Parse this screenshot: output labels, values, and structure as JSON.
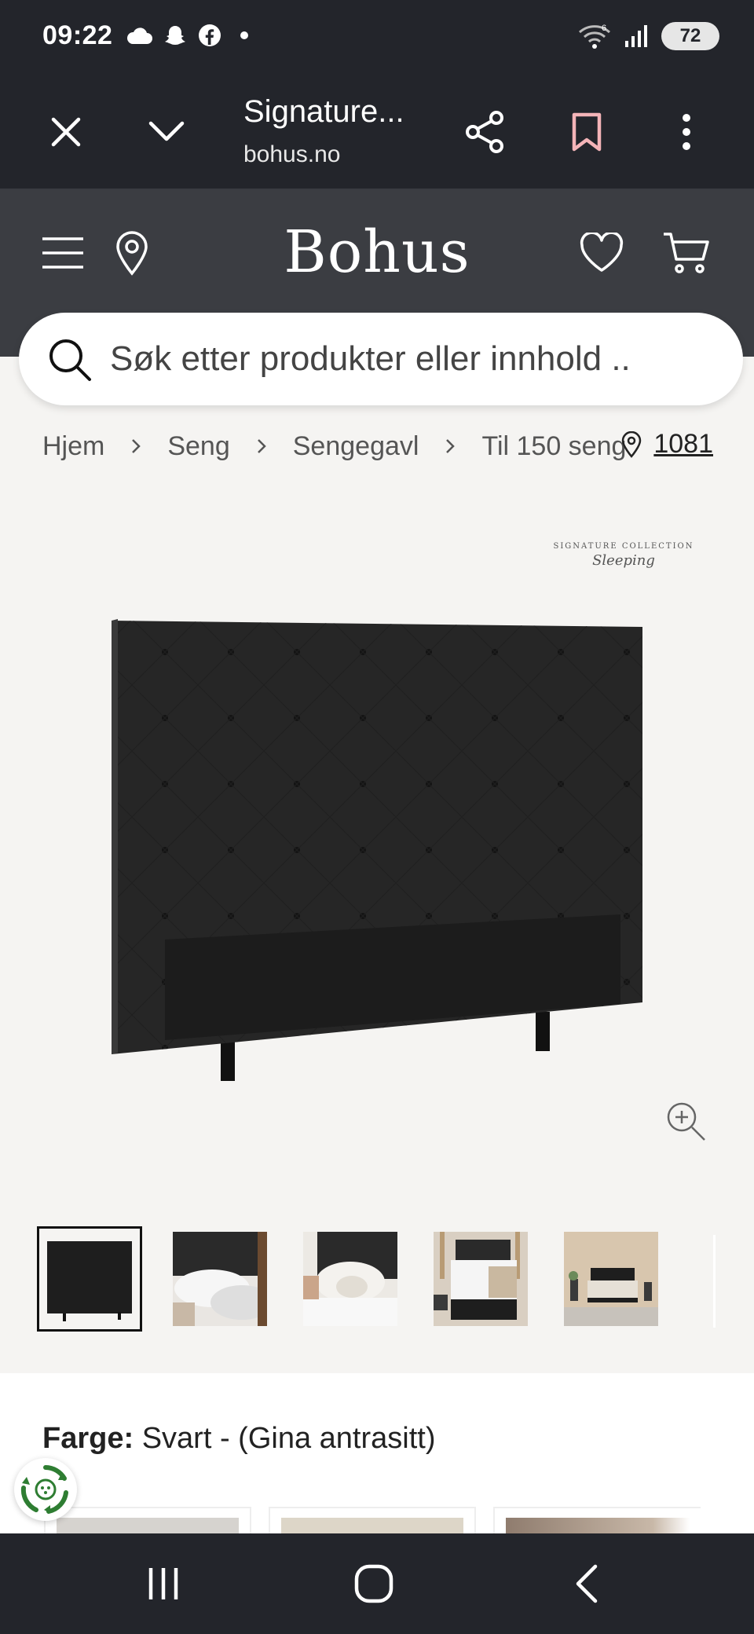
{
  "status_bar": {
    "time": "09:22",
    "left_icons": [
      "cloud-icon",
      "snapchat-icon",
      "facebook-icon",
      "dot-icon"
    ],
    "right_icons": [
      "wifi-icon",
      "signal-icon"
    ],
    "battery": "72"
  },
  "browser": {
    "title": "Signature...",
    "url": "bohus.no",
    "icons": [
      "close-icon",
      "chevron-down-icon",
      "share-icon",
      "bookmark-icon",
      "more-vertical-icon"
    ],
    "bookmark_color": "#f4b4b8"
  },
  "header": {
    "logo": "Bohus",
    "icons": [
      "menu-icon",
      "location-pin-icon",
      "heart-icon",
      "cart-icon"
    ]
  },
  "search": {
    "placeholder": "Søk etter produkter eller innhold .."
  },
  "breadcrumb": {
    "items": [
      "Hjem",
      "Seng",
      "Sengegavl",
      "Til 150 seng"
    ],
    "store_number": "1081"
  },
  "product": {
    "brand_badge_line1": "SIGNATURE COLLECTION",
    "brand_badge_line2": "Sleeping",
    "thumbnails": [
      "Sengegavl front",
      "Sengegavl detalj",
      "Sengegavl med puter",
      "Soverom hvitt sengetøy",
      "Soverom oversikt"
    ]
  },
  "color": {
    "label": "Farge:",
    "value": "Svart - (Gina antrasitt)"
  },
  "colors": {
    "dark_bg": "#23252b",
    "header_bg": "#3b3d42",
    "page_bg": "#f5f4f2"
  }
}
